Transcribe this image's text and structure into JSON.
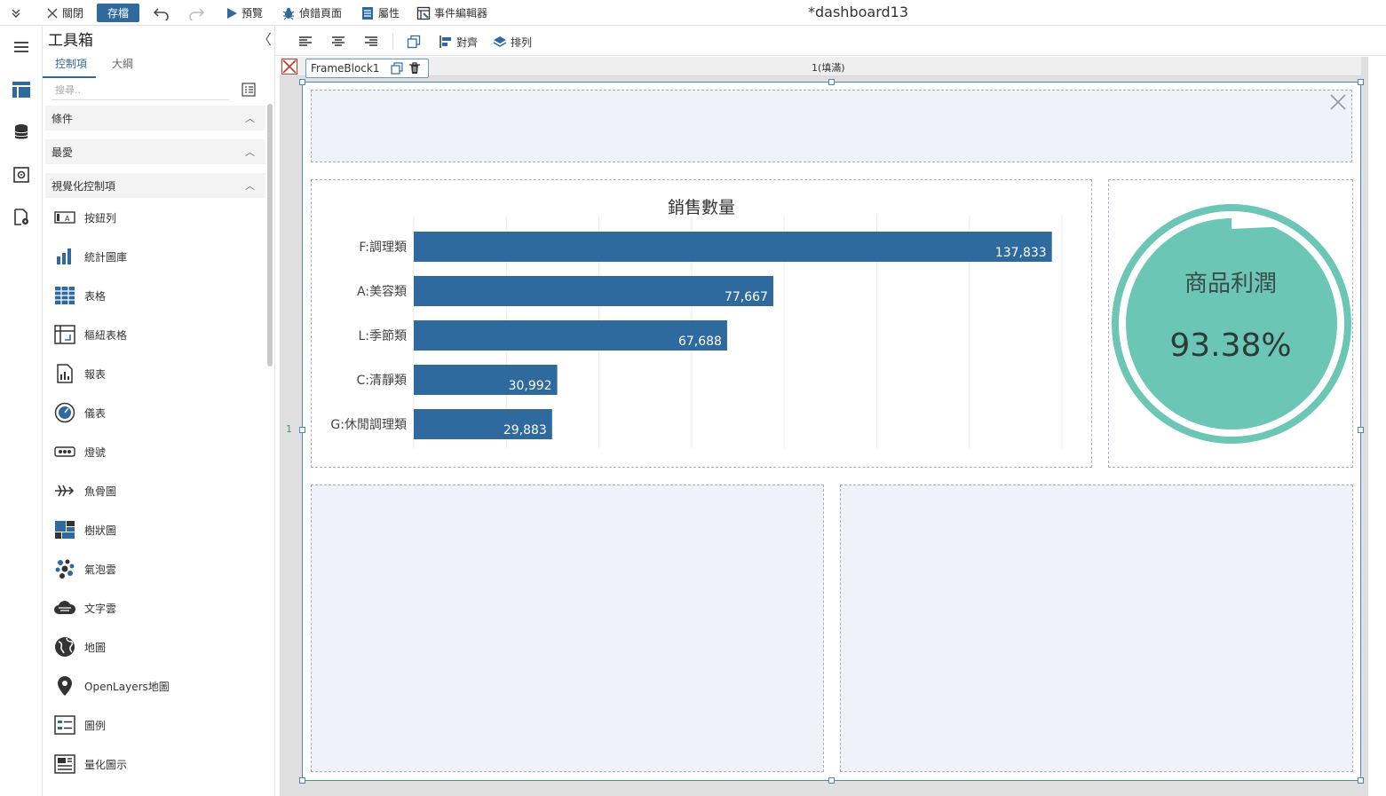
{
  "topbar": {
    "close_label": "關閉",
    "save_label": "存檔",
    "preview_label": "預覽",
    "debug_label": "偵錯頁面",
    "properties_label": "屬性",
    "events_label": "事件編輯器",
    "doc_title": "*dashboard13"
  },
  "toolbox": {
    "title": "工具箱",
    "collapse_glyph": "〈",
    "tabs": [
      {
        "label": "控制項"
      },
      {
        "label": "大綱"
      }
    ],
    "search_placeholder": "搜尋..",
    "sections": [
      {
        "label": "條件"
      },
      {
        "label": "最愛"
      },
      {
        "label": "視覺化控制項"
      }
    ],
    "tools": [
      {
        "label": "按鈕列",
        "icon": "button-bar-icon"
      },
      {
        "label": "統計圖庫",
        "icon": "bar-chart-icon"
      },
      {
        "label": "表格",
        "icon": "table-icon"
      },
      {
        "label": "樞紐表格",
        "icon": "pivot-table-icon"
      },
      {
        "label": "報表",
        "icon": "report-icon"
      },
      {
        "label": "儀表",
        "icon": "gauge-icon"
      },
      {
        "label": "燈號",
        "icon": "signal-lights-icon"
      },
      {
        "label": "魚骨圖",
        "icon": "fishbone-icon"
      },
      {
        "label": "樹狀圖",
        "icon": "treemap-icon"
      },
      {
        "label": "氣泡雲",
        "icon": "bubble-cloud-icon"
      },
      {
        "label": "文字雲",
        "icon": "word-cloud-icon"
      },
      {
        "label": "地圖",
        "icon": "globe-icon"
      },
      {
        "label": "OpenLayers地圖",
        "icon": "map-pin-icon"
      },
      {
        "label": "圖例",
        "icon": "legend-icon"
      },
      {
        "label": "量化圖示",
        "icon": "quantified-icon"
      }
    ]
  },
  "format_bar": {
    "align_label": "對齊",
    "arrange_label": "排列"
  },
  "canvas": {
    "ruler_label": "1(填滿)",
    "frame_name": "FrameBlock1",
    "row_label": "1"
  },
  "gauge": {
    "title": "商品利潤",
    "value_text": "93.38%",
    "percent": 93.38,
    "color": "#6cc6b6"
  },
  "chart_data": {
    "type": "bar",
    "orientation": "horizontal",
    "title": "銷售數量",
    "categories": [
      "F:調理類",
      "A:美容類",
      "L:季節類",
      "C:清靜類",
      "G:休閒調理類"
    ],
    "values": [
      137833,
      77667,
      67688,
      30992,
      29883
    ],
    "value_labels": [
      "137,833",
      "77,667",
      "67,688",
      "30,992",
      "29,883"
    ],
    "xlim": [
      0,
      140000
    ],
    "grid": true,
    "bar_color": "#2f6a9e"
  }
}
